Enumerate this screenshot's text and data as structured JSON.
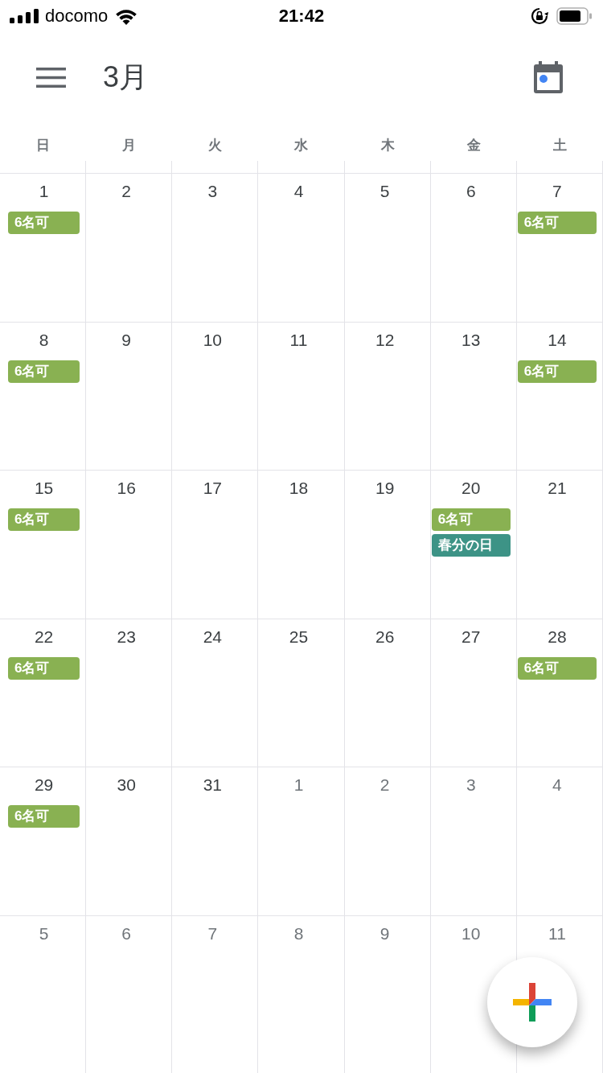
{
  "status_bar": {
    "carrier": "docomo",
    "time": "21:42"
  },
  "header": {
    "title": "3月"
  },
  "weekdays": [
    "日",
    "月",
    "火",
    "水",
    "木",
    "金",
    "土"
  ],
  "weeks": [
    {
      "days": [
        {
          "number": "1",
          "in_month": true,
          "events": [
            {
              "title": "6名可",
              "color": "#89b152"
            }
          ]
        },
        {
          "number": "2",
          "in_month": true
        },
        {
          "number": "3",
          "in_month": true
        },
        {
          "number": "4",
          "in_month": true
        },
        {
          "number": "5",
          "in_month": true
        },
        {
          "number": "6",
          "in_month": true
        },
        {
          "number": "7",
          "in_month": true,
          "events": [
            {
              "title": "6名可",
              "color": "#89b152"
            }
          ]
        }
      ]
    },
    {
      "days": [
        {
          "number": "8",
          "in_month": true,
          "events": [
            {
              "title": "6名可",
              "color": "#89b152"
            }
          ]
        },
        {
          "number": "9",
          "in_month": true
        },
        {
          "number": "10",
          "in_month": true
        },
        {
          "number": "11",
          "in_month": true
        },
        {
          "number": "12",
          "in_month": true
        },
        {
          "number": "13",
          "in_month": true
        },
        {
          "number": "14",
          "in_month": true,
          "events": [
            {
              "title": "6名可",
              "color": "#89b152"
            }
          ]
        }
      ]
    },
    {
      "days": [
        {
          "number": "15",
          "in_month": true,
          "events": [
            {
              "title": "6名可",
              "color": "#89b152"
            }
          ]
        },
        {
          "number": "16",
          "in_month": true
        },
        {
          "number": "17",
          "in_month": true
        },
        {
          "number": "18",
          "in_month": true
        },
        {
          "number": "19",
          "in_month": true
        },
        {
          "number": "20",
          "in_month": true,
          "events": [
            {
              "title": "6名可",
              "color": "#89b152"
            },
            {
              "title": "春分の日",
              "color": "#3d9386"
            }
          ]
        },
        {
          "number": "21",
          "in_month": true
        }
      ]
    },
    {
      "days": [
        {
          "number": "22",
          "in_month": true,
          "events": [
            {
              "title": "6名可",
              "color": "#89b152"
            }
          ]
        },
        {
          "number": "23",
          "in_month": true
        },
        {
          "number": "24",
          "in_month": true
        },
        {
          "number": "25",
          "in_month": true
        },
        {
          "number": "26",
          "in_month": true
        },
        {
          "number": "27",
          "in_month": true
        },
        {
          "number": "28",
          "in_month": true,
          "events": [
            {
              "title": "6名可",
              "color": "#89b152"
            }
          ]
        }
      ]
    },
    {
      "days": [
        {
          "number": "29",
          "in_month": true,
          "events": [
            {
              "title": "6名可",
              "color": "#89b152"
            }
          ]
        },
        {
          "number": "30",
          "in_month": true
        },
        {
          "number": "31",
          "in_month": true
        },
        {
          "number": "1",
          "in_month": false
        },
        {
          "number": "2",
          "in_month": false
        },
        {
          "number": "3",
          "in_month": false
        },
        {
          "number": "4",
          "in_month": false
        }
      ]
    },
    {
      "days": [
        {
          "number": "5",
          "in_month": false
        },
        {
          "number": "6",
          "in_month": false
        },
        {
          "number": "7",
          "in_month": false
        },
        {
          "number": "8",
          "in_month": false
        },
        {
          "number": "9",
          "in_month": false
        },
        {
          "number": "10",
          "in_month": false
        },
        {
          "number": "11",
          "in_month": false
        }
      ]
    }
  ]
}
